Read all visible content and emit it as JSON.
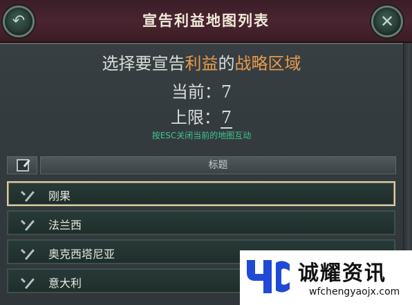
{
  "header": {
    "title": "宣告利益地图列表",
    "back_icon": "back-arrow-icon",
    "close_icon": "close-icon",
    "close_glyph": "✕",
    "back_glyph": "↶"
  },
  "prompt": {
    "part1": "选择要宣告",
    "highlight1": "利益",
    "part2": "的",
    "highlight2": "战略区域",
    "current_label": "当前：",
    "current_value": "7",
    "limit_label": "上限：",
    "limit_value": "7",
    "esc_hint": "按ESC关闭当前的地图互动"
  },
  "table": {
    "title_header": "标题",
    "rows": [
      {
        "label": "刚果",
        "checked": true,
        "selected": true
      },
      {
        "label": "法兰西",
        "checked": true,
        "selected": false
      },
      {
        "label": "奥克西塔尼亚",
        "checked": true,
        "selected": false
      },
      {
        "label": "意大利",
        "checked": true,
        "selected": false
      }
    ]
  },
  "watermark": {
    "name": "诚耀资讯",
    "url": "wfchengyaojx.com"
  },
  "colors": {
    "header_bg": "#4a2430",
    "highlight": "#e79a4a",
    "hint": "#3fc68c",
    "row_bg": "#1e2e2b",
    "logo_blue": "#1f49d6"
  }
}
